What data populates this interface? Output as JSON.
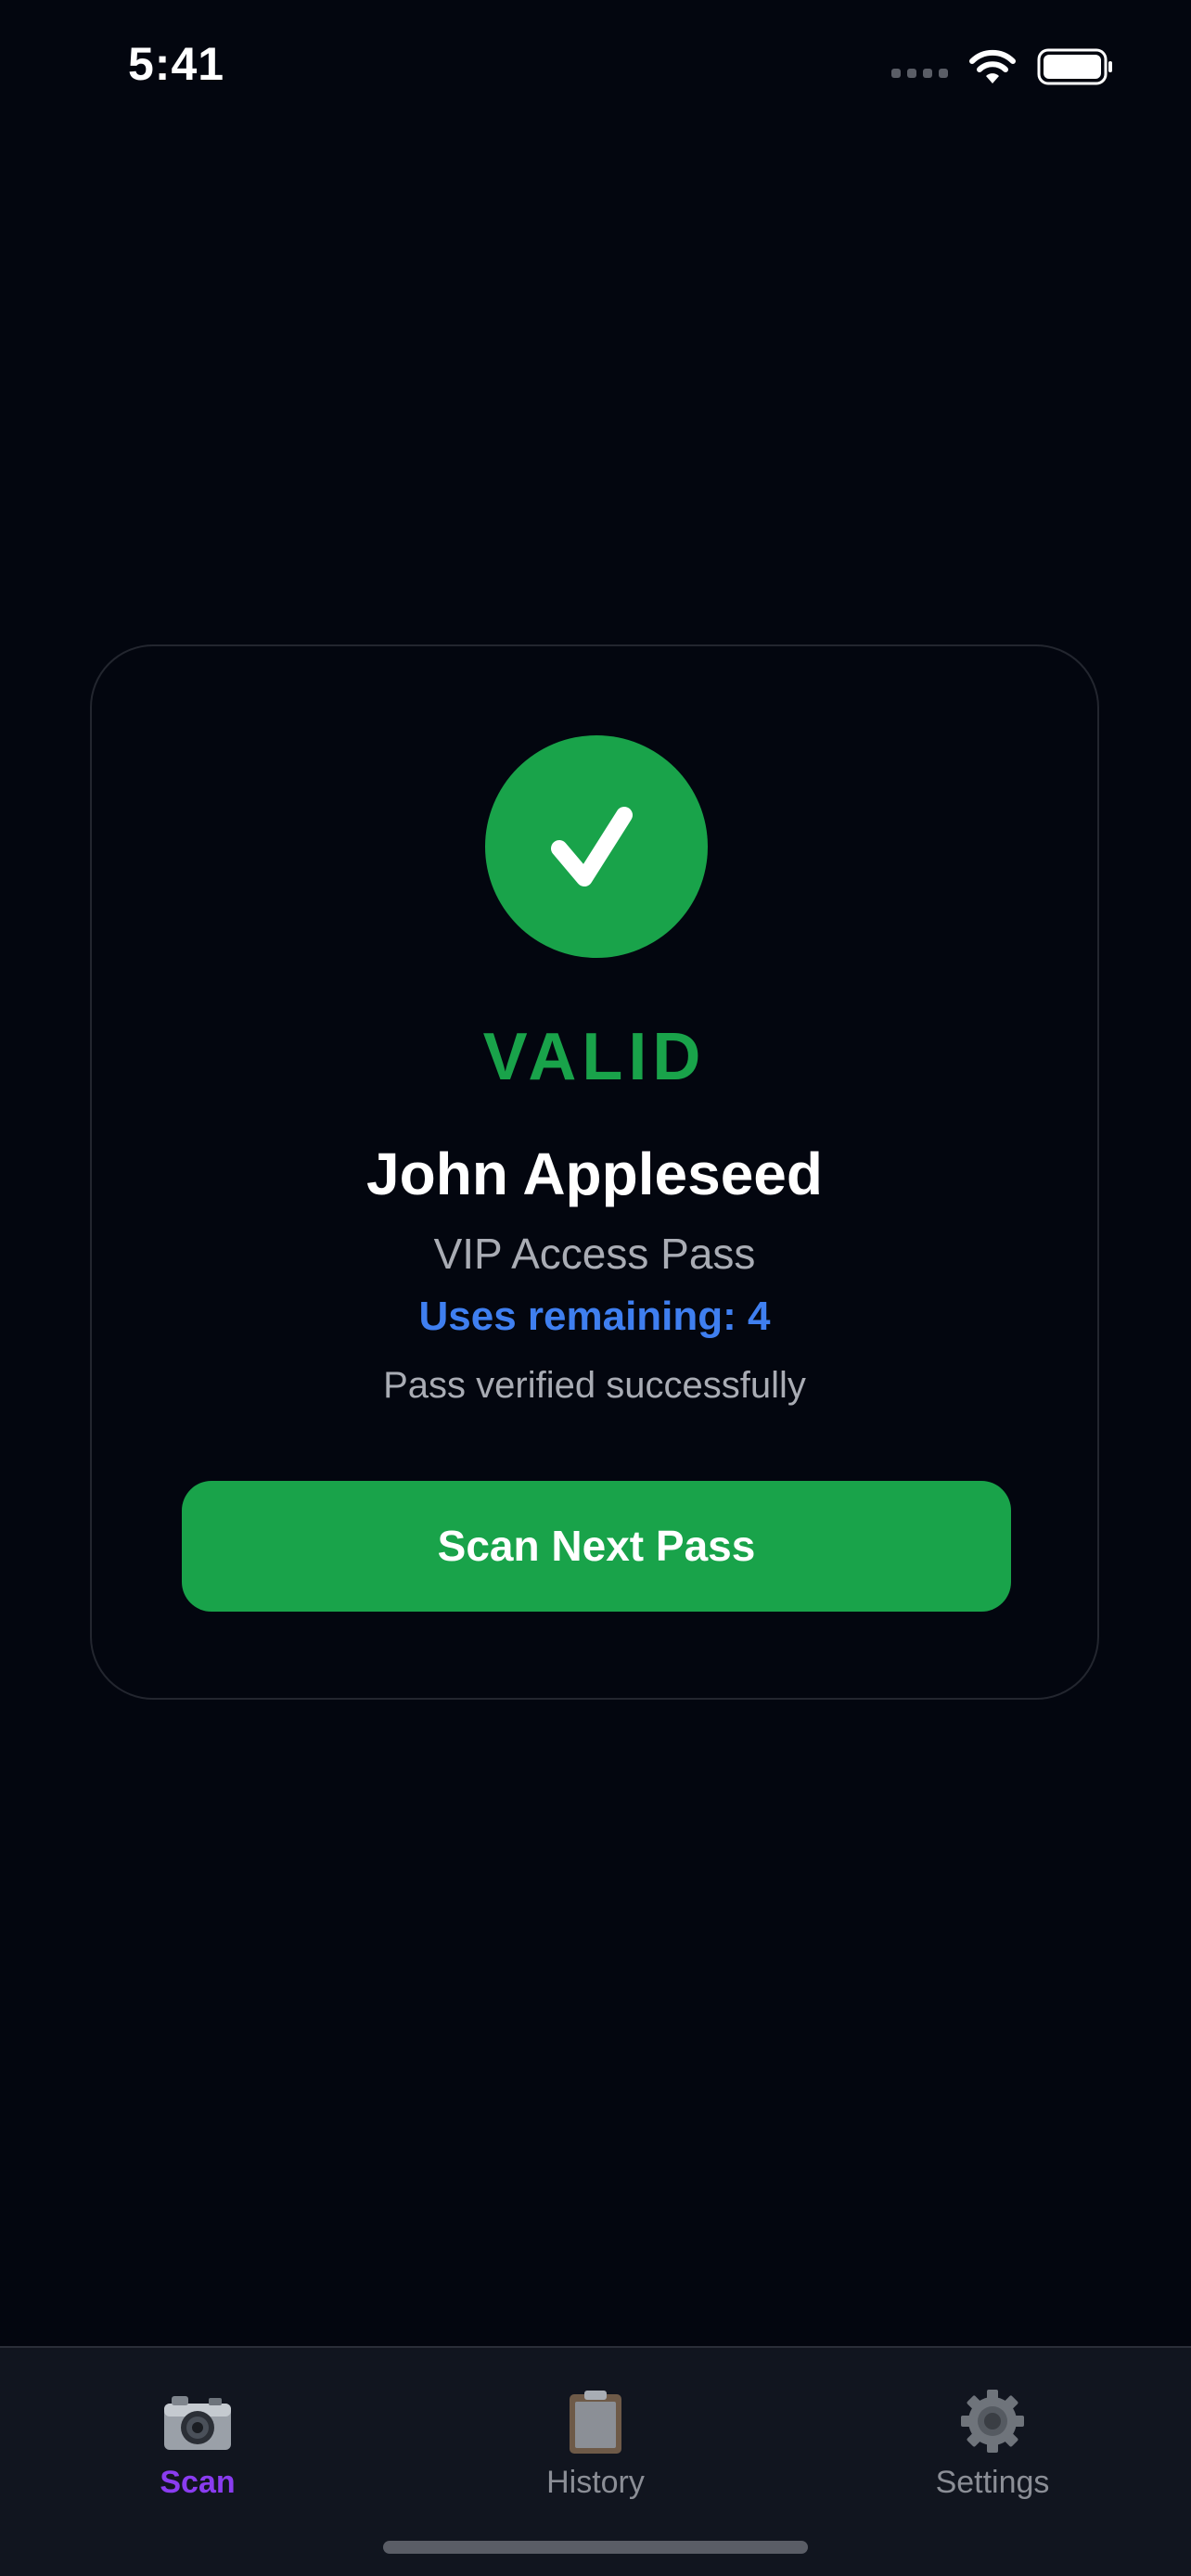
{
  "status_bar": {
    "time": "5:41"
  },
  "result": {
    "status": "VALID",
    "holder_name": "John Appleseed",
    "pass_type": "VIP Access Pass",
    "uses_remaining": "Uses remaining: 4",
    "message": "Pass verified successfully",
    "action_label": "Scan Next Pass",
    "icon": "checkmark-icon",
    "status_color": "#19a34a"
  },
  "tabs": [
    {
      "label": "Scan",
      "icon": "camera-icon",
      "active": true
    },
    {
      "label": "History",
      "icon": "clipboard-icon",
      "active": false
    },
    {
      "label": "Settings",
      "icon": "gear-icon",
      "active": false
    }
  ],
  "colors": {
    "background": "#03060f",
    "accent_green": "#19a34a",
    "accent_blue": "#3f7ff0",
    "active_tab": "#8a3cf0"
  }
}
